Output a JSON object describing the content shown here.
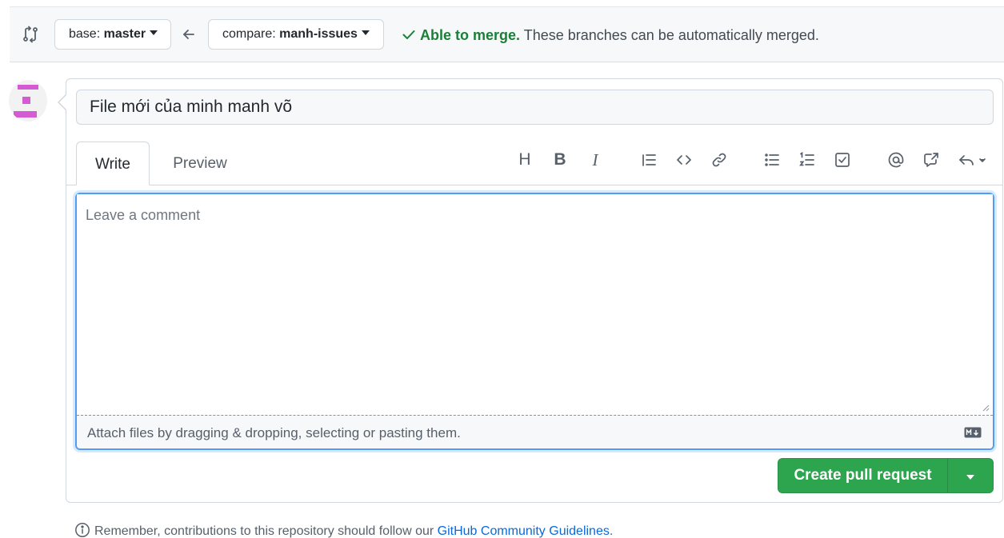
{
  "compare": {
    "base_prefix": "base: ",
    "base_branch": "master",
    "compare_prefix": "compare: ",
    "compare_branch": "manh-issues",
    "merge_ok": "Able to merge.",
    "merge_msg": " These branches can be automatically merged.",
    "status_color": "#1a7f37"
  },
  "pr": {
    "title_value": "File mới của minh manh võ",
    "tabs": [
      {
        "label": "Write",
        "active": true
      },
      {
        "label": "Preview",
        "active": false
      }
    ],
    "toolbar": {
      "heading": "H",
      "bold": "B",
      "italic": "I",
      "icons": [
        "heading-icon",
        "bold-icon",
        "italic-icon",
        "quote-icon",
        "code-icon",
        "link-icon",
        "unordered-list-icon",
        "ordered-list-icon",
        "task-list-icon",
        "mention-icon",
        "reference-icon",
        "saved-replies-icon"
      ]
    },
    "comment_placeholder": "Leave a comment",
    "attach_text": "Attach files by dragging & dropping, selecting or pasting them.",
    "create_label": "Create pull request",
    "accent_color": "#2da44e"
  },
  "footer": {
    "text": "Remember, contributions to this repository should follow our ",
    "link": "GitHub Community Guidelines",
    "end": "."
  }
}
